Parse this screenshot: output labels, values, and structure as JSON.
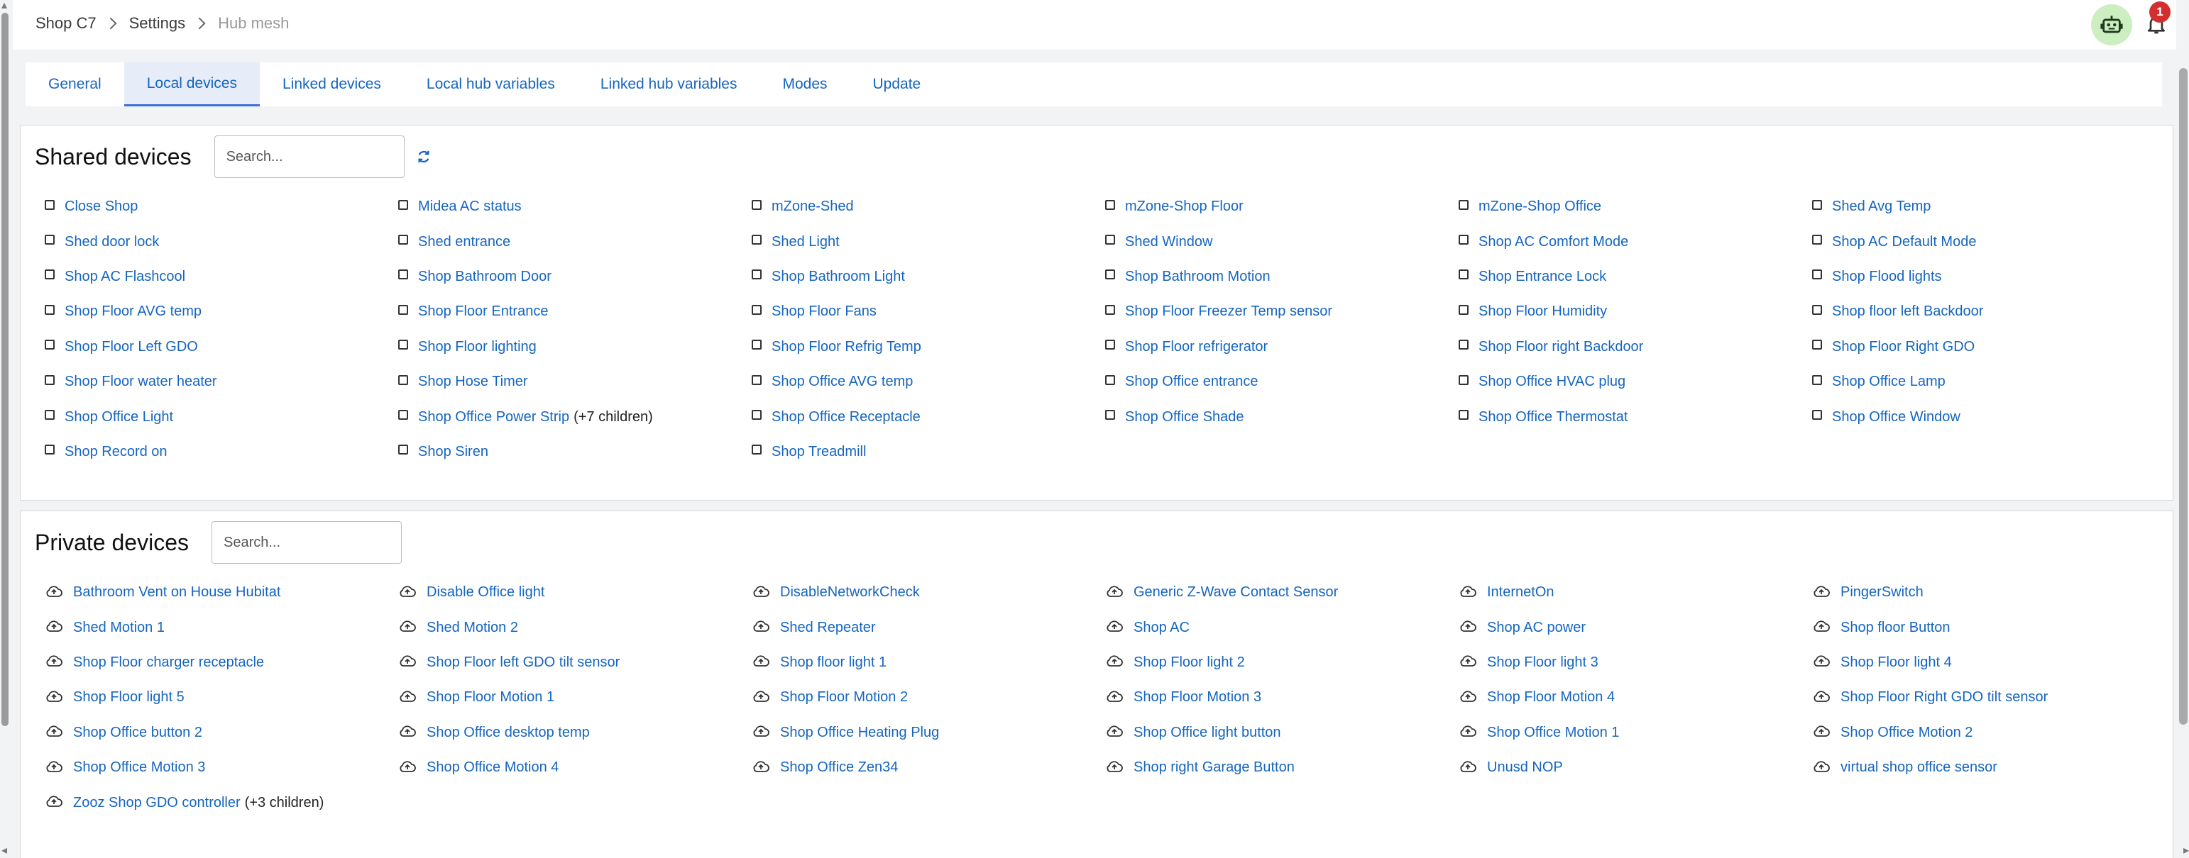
{
  "breadcrumb": [
    "Shop C7",
    "Settings",
    "Hub mesh"
  ],
  "notifications": {
    "count": "1"
  },
  "tabs": [
    {
      "label": "General",
      "active": false
    },
    {
      "label": "Local devices",
      "active": true
    },
    {
      "label": "Linked devices",
      "active": false
    },
    {
      "label": "Local hub variables",
      "active": false
    },
    {
      "label": "Linked hub variables",
      "active": false
    },
    {
      "label": "Modes",
      "active": false
    },
    {
      "label": "Update",
      "active": false
    }
  ],
  "shared": {
    "title": "Shared devices",
    "search_placeholder": "Search...",
    "items": [
      {
        "name": "Close Shop"
      },
      {
        "name": "Midea AC status"
      },
      {
        "name": "mZone-Shed"
      },
      {
        "name": "mZone-Shop Floor"
      },
      {
        "name": "mZone-Shop Office"
      },
      {
        "name": "Shed Avg Temp"
      },
      {
        "name": "Shed door lock"
      },
      {
        "name": "Shed entrance"
      },
      {
        "name": "Shed Light"
      },
      {
        "name": "Shed Window"
      },
      {
        "name": "Shop AC Comfort Mode"
      },
      {
        "name": "Shop AC Default Mode"
      },
      {
        "name": "Shop AC Flashcool"
      },
      {
        "name": "Shop Bathroom Door"
      },
      {
        "name": "Shop Bathroom Light"
      },
      {
        "name": "Shop Bathroom Motion"
      },
      {
        "name": "Shop Entrance Lock"
      },
      {
        "name": "Shop Flood lights"
      },
      {
        "name": "Shop Floor AVG temp"
      },
      {
        "name": "Shop Floor Entrance"
      },
      {
        "name": "Shop Floor Fans"
      },
      {
        "name": "Shop Floor Freezer Temp sensor"
      },
      {
        "name": "Shop Floor Humidity"
      },
      {
        "name": "Shop floor left Backdoor"
      },
      {
        "name": "Shop Floor Left GDO"
      },
      {
        "name": "Shop Floor lighting"
      },
      {
        "name": "Shop Floor Refrig Temp"
      },
      {
        "name": "Shop Floor refrigerator"
      },
      {
        "name": "Shop Floor right Backdoor"
      },
      {
        "name": "Shop Floor Right GDO"
      },
      {
        "name": "Shop Floor water heater"
      },
      {
        "name": "Shop Hose Timer"
      },
      {
        "name": "Shop Office AVG temp"
      },
      {
        "name": "Shop Office entrance"
      },
      {
        "name": "Shop Office HVAC plug"
      },
      {
        "name": "Shop Office Lamp"
      },
      {
        "name": "Shop Office Light"
      },
      {
        "name": "Shop Office Power Strip",
        "suffix": "(+7 children)"
      },
      {
        "name": "Shop Office Receptacle"
      },
      {
        "name": "Shop Office Shade"
      },
      {
        "name": "Shop Office Thermostat"
      },
      {
        "name": "Shop Office Window"
      },
      {
        "name": "Shop Record on"
      },
      {
        "name": "Shop Siren"
      },
      {
        "name": "Shop Treadmill"
      }
    ]
  },
  "private": {
    "title": "Private devices",
    "search_placeholder": "Search...",
    "items": [
      {
        "name": "Bathroom Vent on House Hubitat"
      },
      {
        "name": "Disable Office light"
      },
      {
        "name": "DisableNetworkCheck"
      },
      {
        "name": "Generic Z-Wave Contact Sensor"
      },
      {
        "name": "InternetOn"
      },
      {
        "name": "PingerSwitch"
      },
      {
        "name": "Shed Motion 1"
      },
      {
        "name": "Shed Motion 2"
      },
      {
        "name": "Shed Repeater"
      },
      {
        "name": "Shop AC"
      },
      {
        "name": "Shop AC power"
      },
      {
        "name": "Shop floor Button"
      },
      {
        "name": "Shop Floor charger receptacle"
      },
      {
        "name": "Shop Floor left GDO tilt sensor"
      },
      {
        "name": "Shop floor light 1"
      },
      {
        "name": "Shop Floor light 2"
      },
      {
        "name": "Shop Floor light 3"
      },
      {
        "name": "Shop Floor light 4"
      },
      {
        "name": "Shop Floor light 5"
      },
      {
        "name": "Shop Floor Motion 1"
      },
      {
        "name": "Shop Floor Motion 2"
      },
      {
        "name": "Shop Floor Motion 3"
      },
      {
        "name": "Shop Floor Motion 4"
      },
      {
        "name": "Shop Floor Right GDO tilt sensor"
      },
      {
        "name": "Shop Office button 2"
      },
      {
        "name": "Shop Office desktop temp"
      },
      {
        "name": "Shop Office Heating Plug"
      },
      {
        "name": "Shop Office light button"
      },
      {
        "name": "Shop Office Motion 1"
      },
      {
        "name": "Shop Office Motion 2"
      },
      {
        "name": "Shop Office Motion 3"
      },
      {
        "name": "Shop Office Motion 4"
      },
      {
        "name": "Shop Office Zen34"
      },
      {
        "name": "Shop right Garage Button"
      },
      {
        "name": "Unusd NOP"
      },
      {
        "name": "virtual shop office sensor"
      },
      {
        "name": "Zooz Shop GDO controller",
        "suffix": "(+3 children)"
      }
    ]
  },
  "colors": {
    "link": "#1565c0",
    "accent": "#3b6fd8",
    "badge": "#d32f2f",
    "robot_bg": "#cdeec0"
  }
}
